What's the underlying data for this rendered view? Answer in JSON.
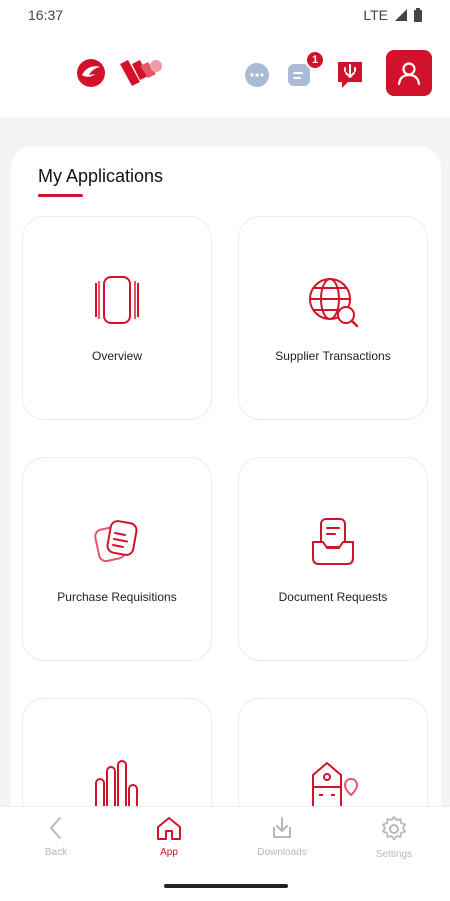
{
  "status_bar": {
    "time": "16:37",
    "network": "LTE"
  },
  "header": {
    "notification_count": "1",
    "icons": [
      "chat-icon",
      "notes-icon",
      "support-icon",
      "profile-icon"
    ]
  },
  "main": {
    "title": "My Applications",
    "tiles": [
      {
        "label": "Overview",
        "icon": "overview-icon"
      },
      {
        "label": "Supplier Transactions",
        "icon": "globe-search-icon"
      },
      {
        "label": "Purchase Requisitions",
        "icon": "documents-icon"
      },
      {
        "label": "Document Requests",
        "icon": "inbox-document-icon"
      },
      {
        "label": "",
        "icon": "bar-chart-icon"
      },
      {
        "label": "",
        "icon": "building-pin-icon"
      }
    ]
  },
  "bottom_nav": [
    {
      "label": "Back",
      "active": false
    },
    {
      "label": "App",
      "active": true
    },
    {
      "label": "Downloads",
      "active": false
    },
    {
      "label": "Settings",
      "active": false
    }
  ],
  "colors": {
    "accent": "#d0132b",
    "inactive": "#b9b9b9",
    "background": "#f3f4f6"
  }
}
